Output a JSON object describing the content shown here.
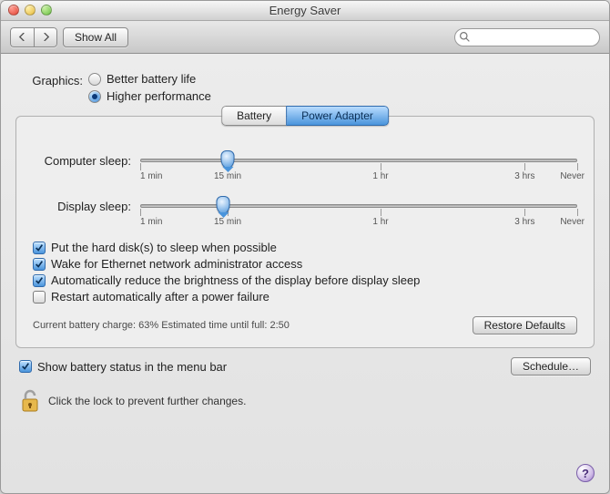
{
  "window": {
    "title": "Energy Saver"
  },
  "toolbar": {
    "show_all": "Show All",
    "search_placeholder": ""
  },
  "graphics": {
    "label": "Graphics:",
    "option1": "Better battery life",
    "option2": "Higher performance",
    "selected": "higher"
  },
  "tabs": {
    "battery": "Battery",
    "power_adapter": "Power Adapter",
    "active": "power_adapter"
  },
  "sliders": {
    "computer": {
      "label": "Computer sleep:",
      "value_pct": 20,
      "ticks": [
        "1 min",
        "15 min",
        "1 hr",
        "3 hrs",
        "Never"
      ]
    },
    "display": {
      "label": "Display sleep:",
      "value_pct": 19,
      "ticks": [
        "1 min",
        "15 min",
        "1 hr",
        "3 hrs",
        "Never"
      ]
    }
  },
  "checks": {
    "hd_sleep": {
      "label": "Put the hard disk(s) to sleep when possible",
      "checked": true
    },
    "wake_ethernet": {
      "label": "Wake for Ethernet network administrator access",
      "checked": true
    },
    "auto_dim": {
      "label": "Automatically reduce the brightness of the display before display sleep",
      "checked": true
    },
    "restart_power": {
      "label": "Restart automatically after a power failure",
      "checked": false
    }
  },
  "status": {
    "text": "Current battery charge: 63%  Estimated time until full: 2:50"
  },
  "buttons": {
    "restore_defaults": "Restore Defaults",
    "schedule": "Schedule…"
  },
  "menubar": {
    "label": "Show battery status in the menu bar",
    "checked": true
  },
  "lock": {
    "text": "Click the lock to prevent further changes."
  },
  "help": "?"
}
